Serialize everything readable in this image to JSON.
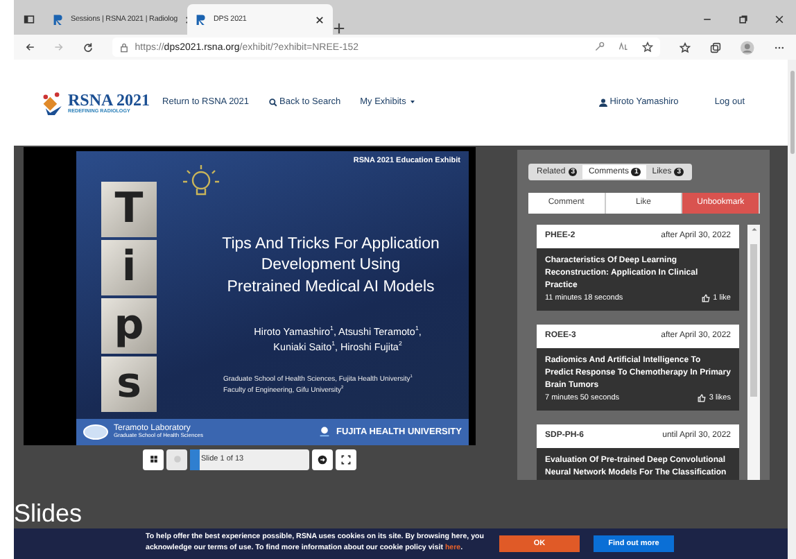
{
  "browser": {
    "tabs": [
      {
        "title": "Sessions | RSNA 2021 | Radiolog",
        "selected": false
      },
      {
        "title": "DPS 2021",
        "selected": true
      }
    ],
    "url": {
      "prefix": "https://",
      "host": "dps2021.rsna.org",
      "path": "/exhibit/?exhibit=NREE-152"
    }
  },
  "header": {
    "logo": {
      "title": "RSNA 2021",
      "tagline": "REDEFINING RADIOLOGY"
    },
    "nav": [
      "Return to RSNA 2021",
      "Back to Search",
      "My Exhibits"
    ],
    "user": "Hiroto Yamashiro",
    "logout": "Log out"
  },
  "slide": {
    "label": "RSNA 2021 Education Exhibit",
    "cubes": [
      "T",
      "i",
      "p",
      "s"
    ],
    "title_lines": [
      "Tips And Tricks For Application",
      "Development Using",
      "Pretrained Medical AI Models"
    ],
    "author_lines": [
      "Hiroto Yamashiro$^{1}$, Atsushi Teramoto$^{1}$,",
      "Kuniaki Saito$^{1}$, Hiroshi Fujita$^{2}$"
    ],
    "affiliations": [
      "Graduate School of Health Sciences, Fujita Health University$^{1}$",
      "Faculty of Engineering, Gifu University$^{2}$"
    ],
    "lab": "Teramoto Laboratory",
    "lab_sub": "Graduate School of Health Sciences",
    "university": "FUJITA HEALTH UNIVERSITY"
  },
  "viewer_controls": {
    "slide_field": "Slide 1 of 13",
    "level": 0.077
  },
  "panel": {
    "tabs": [
      {
        "label": "Related",
        "count": "3",
        "selected": false
      },
      {
        "label": "Comments",
        "count": "1",
        "selected": true
      },
      {
        "label": "Likes",
        "count": "3",
        "selected": false
      }
    ],
    "actions": [
      {
        "label": "Comment",
        "kind": "plain"
      },
      {
        "label": "Like",
        "kind": "plain"
      },
      {
        "label": "Unbookmark",
        "kind": "danger"
      }
    ],
    "exhibits": [
      {
        "code": "PHEE-2",
        "date": "after April 30, 2022",
        "title": "Characteristics Of Deep Learning Reconstruction: Application In Clinical Practice",
        "duration": "11 minutes 18 seconds",
        "likes": "1 like"
      },
      {
        "code": "ROEE-3",
        "date": "after April 30, 2022",
        "title": "Radiomics And Artificial Intelligence To Predict Response To Chemotherapy In Primary Brain Tumors",
        "duration": "7 minutes 50 seconds",
        "likes": "3 likes"
      },
      {
        "code": "SDP-PH-6",
        "date": "until April 30, 2022",
        "title": "Evaluation Of Pre-trained Deep Convolutional Neural Network Models For The Classification"
      }
    ]
  },
  "section_title": "Slides",
  "cookie_banner": {
    "text": "To help offer the best experience possible, RSNA uses cookies on its site. By browsing here, you acknowledge our terms of use. To find more information about our cookie policy visit ",
    "link": "here",
    "suffix": ".",
    "buttons": [
      {
        "label": "OK",
        "kind": "accept"
      },
      {
        "label": "Find out more",
        "kind": "info"
      }
    ]
  }
}
